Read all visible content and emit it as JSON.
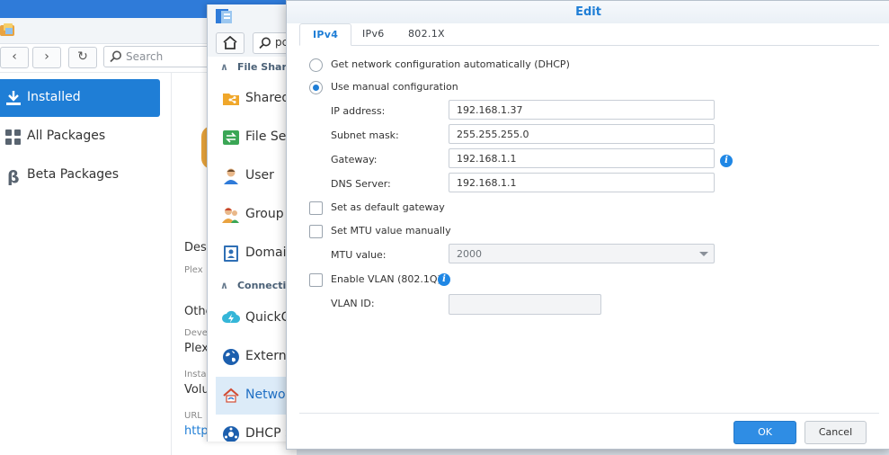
{
  "package_center": {
    "toolbar": {
      "search_placeholder": "Search"
    },
    "sidebar": {
      "items": [
        {
          "label": "Installed",
          "icon": "download-icon"
        },
        {
          "label": "All Packages",
          "icon": "grid-icon"
        },
        {
          "label": "Beta Packages",
          "icon": "beta-icon"
        }
      ]
    },
    "detail": {
      "desc_heading": "Desc",
      "desc_sub": "Plex",
      "other_heading": "Othe",
      "developer_label": "Deve",
      "developer_value": "Plex",
      "installed_label": "Insta",
      "installed_value": "Volu",
      "url_label": "URL",
      "url_value": "http"
    }
  },
  "control_panel": {
    "search_value": "pc",
    "sections": [
      {
        "label": "File Shar",
        "items": [
          {
            "label": "Shared",
            "icon": "shared-folder-icon"
          },
          {
            "label": "File Ser",
            "icon": "file-services-icon"
          },
          {
            "label": "User",
            "icon": "user-icon"
          },
          {
            "label": "Group",
            "icon": "group-icon"
          },
          {
            "label": "Domain",
            "icon": "domain-icon"
          }
        ]
      },
      {
        "label": "Connecti",
        "items": [
          {
            "label": "QuickCo",
            "icon": "quickconnect-icon"
          },
          {
            "label": "Externa",
            "icon": "external-access-icon"
          },
          {
            "label": "Networ",
            "icon": "network-icon",
            "active": true
          },
          {
            "label": "DHCP S",
            "icon": "dhcp-icon"
          }
        ]
      }
    ]
  },
  "dialog": {
    "title": "Edit",
    "tabs": [
      "IPv4",
      "IPv6",
      "802.1X"
    ],
    "active_tab": "IPv4",
    "radio_dhcp": "Get network configuration automatically (DHCP)",
    "radio_manual": "Use manual configuration",
    "fields": {
      "ip_label": "IP address:",
      "ip_value": "192.168.1.37",
      "subnet_label": "Subnet mask:",
      "subnet_value": "255.255.255.0",
      "gateway_label": "Gateway:",
      "gateway_value": "192.168.1.1",
      "dns_label": "DNS Server:",
      "dns_value": "192.168.1.1"
    },
    "default_gateway_label": "Set as default gateway",
    "mtu_manual_label": "Set MTU value manually",
    "mtu_label": "MTU value:",
    "mtu_value": "2000",
    "vlan_enable_label": "Enable VLAN (802.1Q)",
    "vlan_id_label": "VLAN ID:",
    "vlan_id_value": "",
    "ok_label": "OK",
    "cancel_label": "Cancel"
  },
  "colors": {
    "accent": "#1f7ed6",
    "info": "#1f87e5"
  }
}
